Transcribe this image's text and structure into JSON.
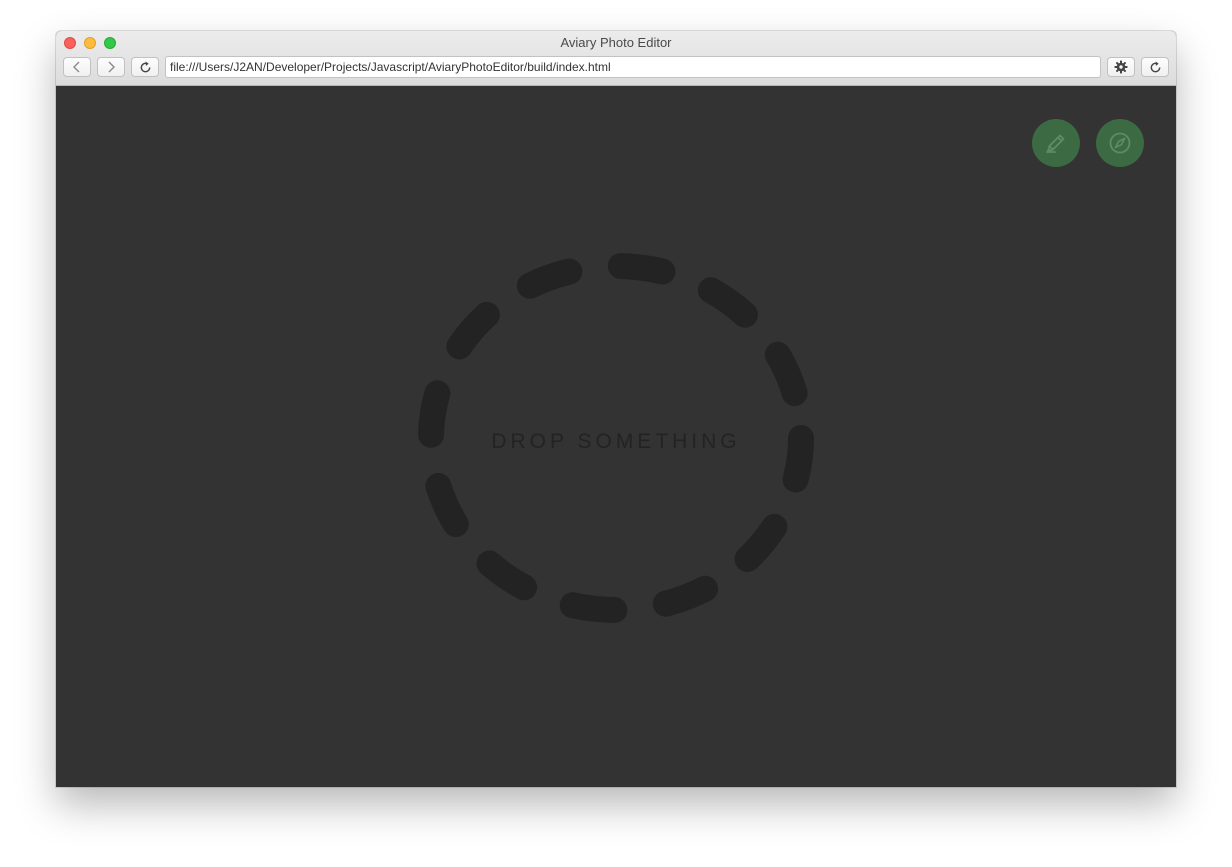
{
  "window": {
    "title": "Aviary Photo Editor"
  },
  "toolbar": {
    "url": "file:///Users/J2AN/Developer/Projects/Javascript/AviaryPhotoEditor/build/index.html",
    "back_icon": "chevron-left-icon",
    "forward_icon": "chevron-right-icon",
    "reload_icon": "reload-icon",
    "settings_icon": "gear-icon",
    "refresh_icon": "refresh-icon"
  },
  "actions": {
    "edit_icon": "pencil-icon",
    "explore_icon": "compass-icon"
  },
  "dropzone": {
    "label": "DROP SOMETHING"
  },
  "colors": {
    "background": "#333333",
    "dropzone_stroke": "#232323",
    "fab": "#3c6a42",
    "fab_icon": "#5e8c63"
  }
}
